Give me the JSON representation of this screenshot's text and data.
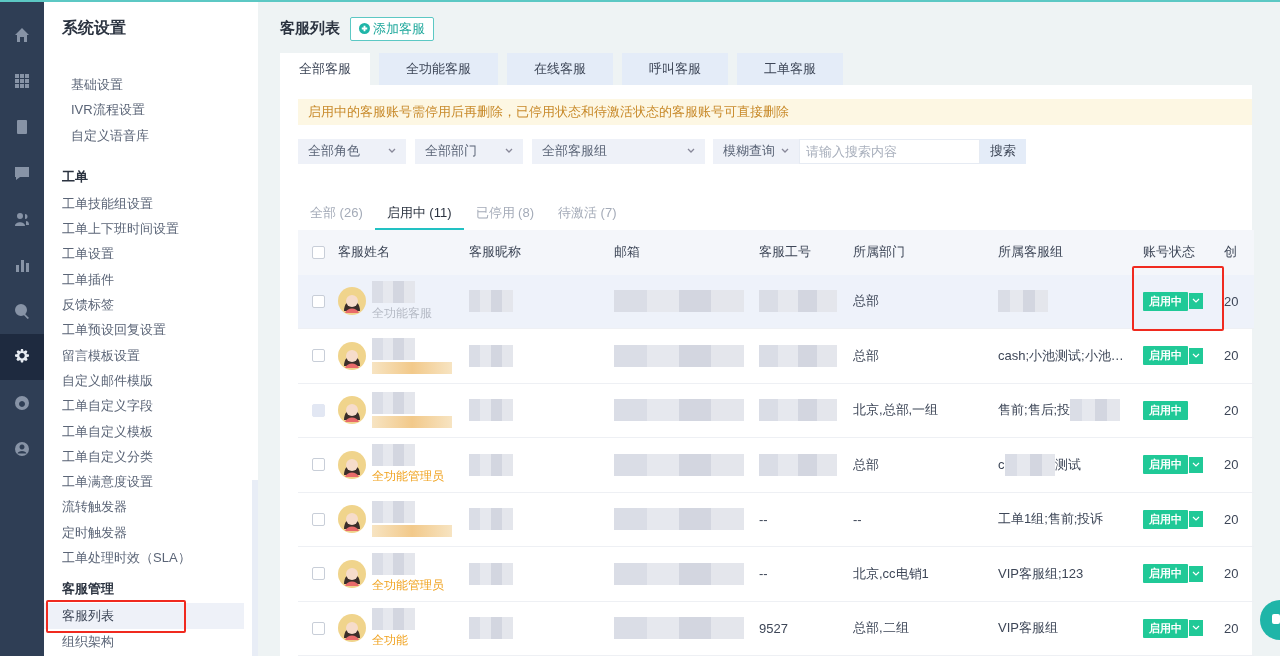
{
  "rail": [
    {
      "selected": false
    },
    {
      "selected": false
    },
    {
      "selected": false
    },
    {
      "selected": false
    },
    {
      "selected": false
    },
    {
      "selected": false
    },
    {
      "selected": false
    },
    {
      "selected": true
    },
    {
      "selected": false
    },
    {
      "selected": false
    }
  ],
  "sidebar": {
    "title": "系统设置",
    "sections": [
      {
        "items": [
          {
            "label": "基础设置",
            "indent": true,
            "selected": false,
            "annotated": false
          },
          {
            "label": "IVR流程设置",
            "indent": true,
            "selected": false,
            "annotated": false
          },
          {
            "label": "自定义语音库",
            "indent": true,
            "selected": false,
            "annotated": false
          }
        ]
      },
      {
        "title": "工单",
        "items": [
          {
            "label": "工单技能组设置",
            "indent": false,
            "selected": false,
            "annotated": false
          },
          {
            "label": "工单上下班时间设置",
            "indent": false,
            "selected": false,
            "annotated": false
          },
          {
            "label": "工单设置",
            "indent": false,
            "selected": false,
            "annotated": false
          },
          {
            "label": "工单插件",
            "indent": false,
            "selected": false,
            "annotated": false
          },
          {
            "label": "反馈标签",
            "indent": false,
            "selected": false,
            "annotated": false
          },
          {
            "label": "工单预设回复设置",
            "indent": false,
            "selected": false,
            "annotated": false
          },
          {
            "label": "留言模板设置",
            "indent": false,
            "selected": false,
            "annotated": false
          },
          {
            "label": "自定义邮件模版",
            "indent": false,
            "selected": false,
            "annotated": false
          },
          {
            "label": "工单自定义字段",
            "indent": false,
            "selected": false,
            "annotated": false
          },
          {
            "label": "工单自定义模板",
            "indent": false,
            "selected": false,
            "annotated": false
          },
          {
            "label": "工单自定义分类",
            "indent": false,
            "selected": false,
            "annotated": false
          },
          {
            "label": "工单满意度设置",
            "indent": false,
            "selected": false,
            "annotated": false
          },
          {
            "label": "流转触发器",
            "indent": false,
            "selected": false,
            "annotated": false
          },
          {
            "label": "定时触发器",
            "indent": false,
            "selected": false,
            "annotated": false
          },
          {
            "label": "工单处理时效（SLA）",
            "indent": false,
            "selected": false,
            "annotated": false
          }
        ]
      },
      {
        "title": "客服管理",
        "items": [
          {
            "label": "客服列表",
            "indent": false,
            "selected": true,
            "annotated": true
          },
          {
            "label": "组织架构",
            "indent": false,
            "selected": false,
            "annotated": false
          }
        ]
      }
    ]
  },
  "page_title": "客服列表",
  "add_button": "添加客服",
  "tabs": [
    {
      "label": "全部客服",
      "selected": true
    },
    {
      "label": "全功能客服",
      "selected": false
    },
    {
      "label": "在线客服",
      "selected": false
    },
    {
      "label": "呼叫客服",
      "selected": false
    },
    {
      "label": "工单客服",
      "selected": false
    }
  ],
  "notice": "启用中的客服账号需停用后再删除，已停用状态和待激活状态的客服账号可直接删除",
  "filters": [
    {
      "label": "全部角色",
      "wide": false
    },
    {
      "label": "全部部门",
      "wide": false
    },
    {
      "label": "全部客服组",
      "wide": true
    }
  ],
  "search": {
    "mode": "模糊查询",
    "placeholder": "请输入搜索内容",
    "button": "搜索"
  },
  "status_tabs": [
    {
      "label": "全部 (26)",
      "selected": false
    },
    {
      "label": "启用中 (11)",
      "selected": true
    },
    {
      "label": "已停用 (8)",
      "selected": false
    },
    {
      "label": "待激活 (7)",
      "selected": false
    }
  ],
  "header_checked": false,
  "columns": [
    "客服姓名",
    "客服昵称",
    "邮箱",
    "客服工号",
    "所属部门",
    "所属客服组",
    "账号状态",
    "创"
  ],
  "rows": [
    {
      "checked": false,
      "disabled": false,
      "highlighted": true,
      "role": {
        "text": "全功能客服",
        "kind": "agent"
      },
      "agent_id": [
        {
          "kind": "redacted"
        }
      ],
      "dept": "总部",
      "group": [
        {
          "kind": "redacted"
        }
      ],
      "status": "启用中",
      "has_menu": true,
      "annotated": true,
      "created": "20"
    },
    {
      "checked": false,
      "disabled": false,
      "highlighted": false,
      "role": {
        "kind": "hidden"
      },
      "agent_id": [
        {
          "kind": "redacted"
        }
      ],
      "dept": "总部",
      "group": [
        {
          "kind": "text",
          "text": "cash;小池测试;小池…"
        }
      ],
      "status": "启用中",
      "has_menu": true,
      "annotated": false,
      "created": "20"
    },
    {
      "checked": false,
      "disabled": true,
      "highlighted": false,
      "role": {
        "kind": "hidden"
      },
      "agent_id": [
        {
          "kind": "redacted"
        }
      ],
      "dept": "北京,总部,一组",
      "group": [
        {
          "kind": "text",
          "text": "售前;售后;投"
        },
        {
          "kind": "redacted"
        }
      ],
      "status": "启用中",
      "has_menu": false,
      "annotated": false,
      "created": "20"
    },
    {
      "checked": false,
      "disabled": false,
      "highlighted": false,
      "role": {
        "text": "全功能管理员",
        "kind": "admin"
      },
      "agent_id": [
        {
          "kind": "redacted"
        }
      ],
      "dept": "总部",
      "group": [
        {
          "kind": "text",
          "text": "c"
        },
        {
          "kind": "redacted"
        },
        {
          "kind": "text",
          "text": "测试"
        }
      ],
      "status": "启用中",
      "has_menu": true,
      "annotated": false,
      "created": "20"
    },
    {
      "checked": false,
      "disabled": false,
      "highlighted": false,
      "role": {
        "kind": "hidden"
      },
      "agent_id": [
        {
          "kind": "text",
          "text": "--"
        }
      ],
      "dept": "--",
      "group": [
        {
          "kind": "text",
          "text": "工单1组;售前;投诉"
        }
      ],
      "status": "启用中",
      "has_menu": true,
      "annotated": false,
      "created": "20"
    },
    {
      "checked": false,
      "disabled": false,
      "highlighted": false,
      "role": {
        "text": "全功能管理员",
        "kind": "admin"
      },
      "agent_id": [
        {
          "kind": "text",
          "text": "--"
        }
      ],
      "dept": "北京,cc电销1",
      "group": [
        {
          "kind": "text",
          "text": "VIP客服组;123"
        }
      ],
      "status": "启用中",
      "has_menu": true,
      "annotated": false,
      "created": "20"
    },
    {
      "checked": false,
      "disabled": false,
      "highlighted": false,
      "role": {
        "text": "全功能",
        "kind": "admin"
      },
      "agent_id": [
        {
          "kind": "text",
          "text": "9527"
        }
      ],
      "dept": "总部,二组",
      "group": [
        {
          "kind": "text",
          "text": "VIP客服组"
        }
      ],
      "status": "启用中",
      "has_menu": true,
      "annotated": false,
      "created": "20"
    }
  ]
}
